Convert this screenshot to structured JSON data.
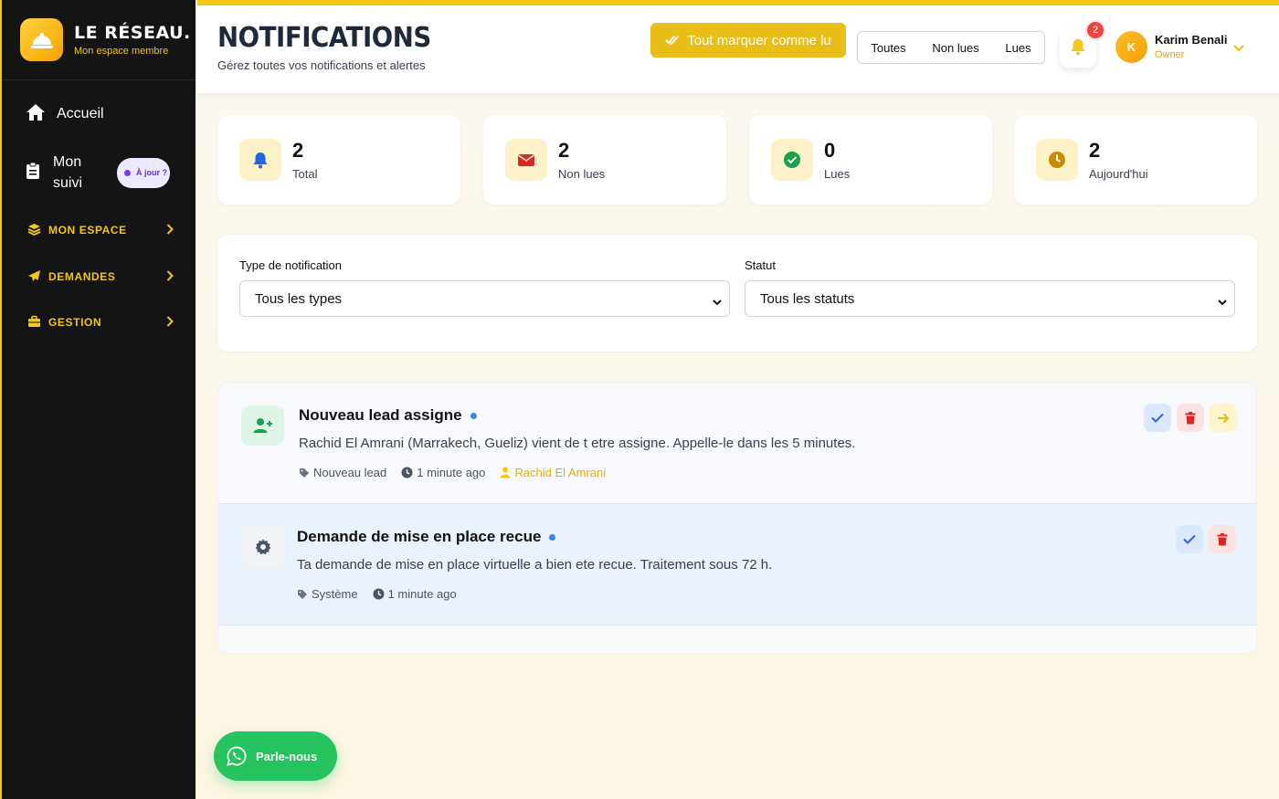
{
  "brand": {
    "title": "LE RÉSEAU.",
    "subtitle": "Mon espace membre"
  },
  "sidebar": {
    "home": "Accueil",
    "suivi": "Mon suivi",
    "suivi_badge": "À jour ?",
    "sections": [
      {
        "label": "MON ESPACE"
      },
      {
        "label": "DEMANDES"
      },
      {
        "label": "GESTION"
      }
    ]
  },
  "header": {
    "title": "NOTIFICATIONS",
    "subtitle": "Gérez toutes vos notifications et alertes",
    "mark_all": "Tout marquer comme lu",
    "tabs": [
      "Toutes",
      "Non lues",
      "Lues"
    ],
    "bell_count": "2",
    "user": {
      "initial": "K",
      "name": "Karim Benali",
      "role": "Owner"
    }
  },
  "stats": [
    {
      "value": "2",
      "label": "Total",
      "icon": "bell-icon"
    },
    {
      "value": "2",
      "label": "Non lues",
      "icon": "envelope-icon"
    },
    {
      "value": "0",
      "label": "Lues",
      "icon": "check-circle-icon"
    },
    {
      "value": "2",
      "label": "Aujourd'hui",
      "icon": "clock-icon"
    }
  ],
  "filters": {
    "type_label": "Type de notification",
    "type_value": "Tous les types",
    "status_label": "Statut",
    "status_value": "Tous les statuts"
  },
  "notifications": [
    {
      "title": "Nouveau lead assigne",
      "message": "Rachid El Amrani (Marrakech, Gueliz) vient de t etre assigne. Appelle-le dans les 5 minutes.",
      "tag": "Nouveau lead",
      "time": "1 minute ago",
      "lead": "Rachid El Amrani",
      "icon": "user-plus-icon"
    },
    {
      "title": "Demande de mise en place recue",
      "message": "Ta demande de mise en place virtuelle a bien ete recue. Traitement sous 72 h.",
      "tag": "Système",
      "time": "1 minute ago",
      "icon": "gear-icon"
    }
  ],
  "whatsapp": {
    "label": "Parle-nous"
  },
  "colors": {
    "accent": "#f5c518",
    "sidebar": "#141414",
    "whatsapp": "#25c45f",
    "unread_dot": "#3b82f6"
  }
}
